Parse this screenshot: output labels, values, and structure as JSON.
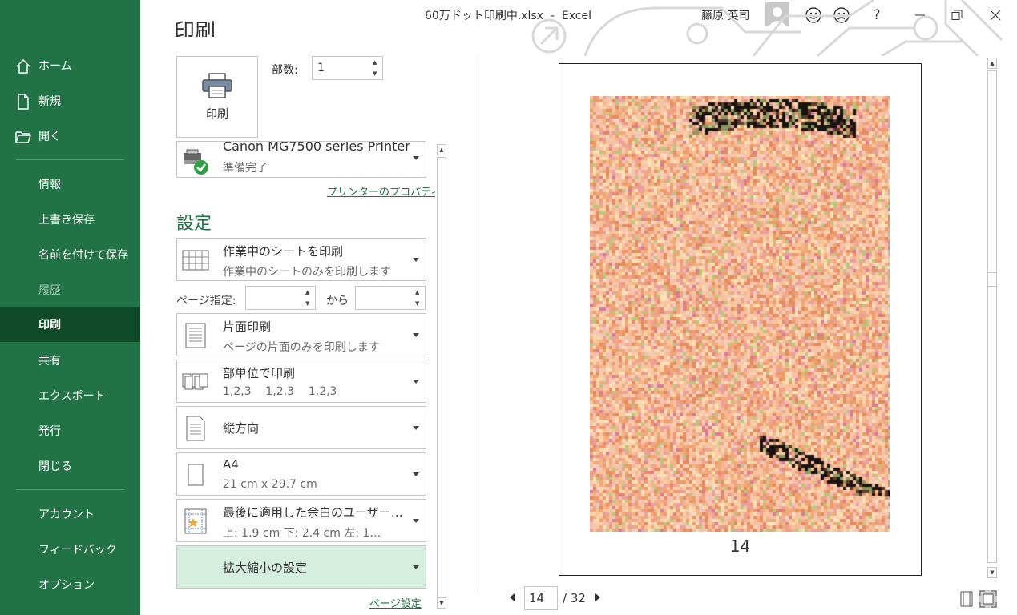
{
  "window": {
    "title": "60万ドット印刷中.xlsx  -  Excel",
    "user_name": "藤原 英司",
    "help_label": "?"
  },
  "sidebar": {
    "items": [
      {
        "label": "ホーム"
      },
      {
        "label": "新規"
      },
      {
        "label": "開く"
      },
      {
        "label": "情報"
      },
      {
        "label": "上書き保存"
      },
      {
        "label": "名前を付けて保存"
      },
      {
        "label": "履歴"
      },
      {
        "label": "印刷"
      },
      {
        "label": "共有"
      },
      {
        "label": "エクスポート"
      },
      {
        "label": "発行"
      },
      {
        "label": "閉じる"
      },
      {
        "label": "アカウント"
      },
      {
        "label": "フィードバック"
      },
      {
        "label": "オプション"
      }
    ]
  },
  "print": {
    "heading": "印刷",
    "button_label": "印刷",
    "copies_label": "部数:",
    "copies_value": "1",
    "printer_name": "Canon MG7500 series Printer",
    "printer_status": "準備完了",
    "printer_properties_link": "プリンターのプロパティ",
    "settings_title": "設定",
    "pages_label": "ページ指定:",
    "pages_to_label": "から",
    "pages_from_value": "",
    "pages_to_value": "",
    "page_setup_link": "ページ設定",
    "settings": [
      {
        "l1": "作業中のシートを印刷",
        "l2": "作業中のシートのみを印刷します"
      },
      {
        "l1": "片面印刷",
        "l2": "ページの片面のみを印刷します"
      },
      {
        "l1": "部単位で印刷",
        "l2": "1,2,3    1,2,3    1,2,3"
      },
      {
        "l1": "縦方向",
        "l2": ""
      },
      {
        "l1": "A4",
        "l2": "21 cm x 29.7 cm"
      },
      {
        "l1": "最後に適用した余白のユーザー…",
        "l2": "上: 1.9 cm 下: 2.4 cm 左: 1…"
      },
      {
        "l1": "拡大縮小の設定",
        "l2": ""
      }
    ]
  },
  "preview": {
    "page_number_label": "14",
    "current_page": "14",
    "total_pages_label": "/ 32"
  },
  "colors": {
    "accent": "#217346",
    "active_nav": "#0e4a27",
    "highlight": "#d5eedf"
  }
}
